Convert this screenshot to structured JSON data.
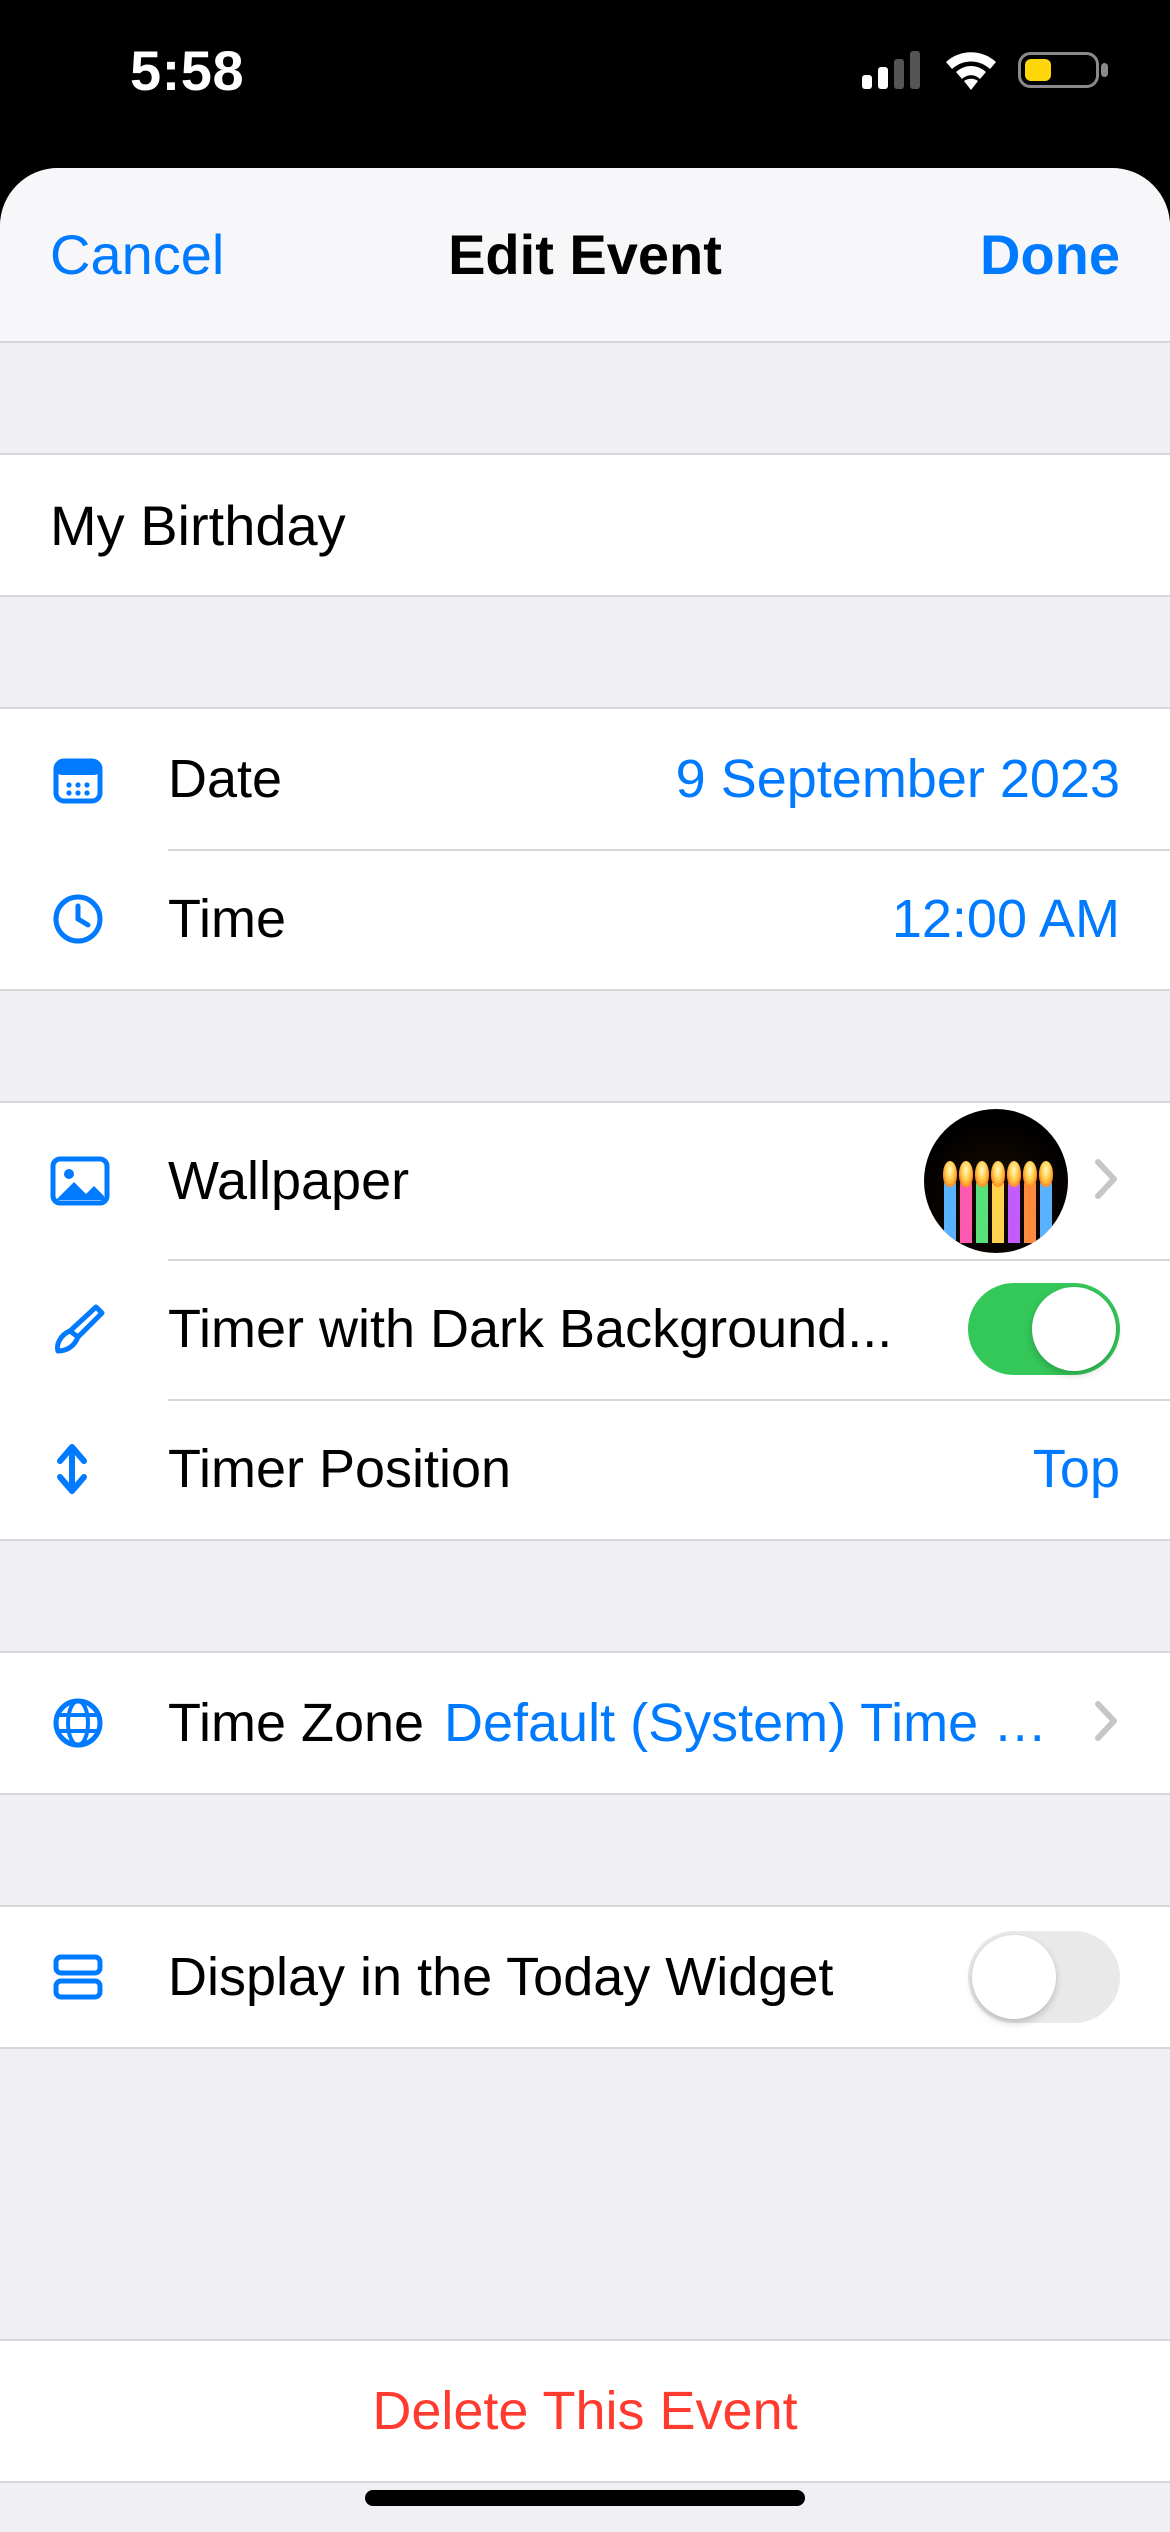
{
  "status": {
    "time": "5:58"
  },
  "nav": {
    "cancel": "Cancel",
    "title": "Edit Event",
    "done": "Done"
  },
  "event": {
    "title": "My Birthday"
  },
  "datetime": {
    "date_label": "Date",
    "date_value": "9 September 2023",
    "time_label": "Time",
    "time_value": "12:00 AM"
  },
  "appearance": {
    "wallpaper_label": "Wallpaper",
    "dark_bg_label": "Timer with Dark Background...",
    "dark_bg_on": true,
    "position_label": "Timer Position",
    "position_value": "Top"
  },
  "timezone": {
    "label": "Time Zone",
    "value": "Default (System) Time Z..."
  },
  "widget": {
    "label": "Display in the Today Widget",
    "on": false
  },
  "delete": {
    "label": "Delete This Event"
  }
}
